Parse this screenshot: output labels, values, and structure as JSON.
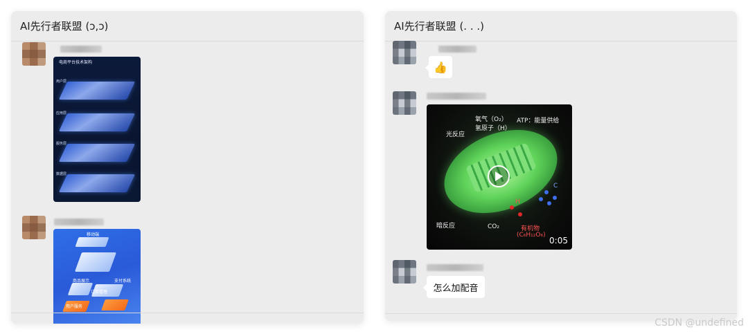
{
  "left_panel": {
    "title": "AI先行者联盟 (ɔ,ɔ)",
    "messages": [
      {
        "type": "image",
        "image_title": "电商平台技术架构",
        "layer_labels": [
          "用户层",
          "应用层",
          "服务层",
          "数据层"
        ]
      },
      {
        "type": "image",
        "image_labels": [
          "移动端",
          "商品展示",
          "订单管理",
          "支付系统",
          "用户服务"
        ]
      }
    ]
  },
  "right_panel": {
    "title": "AI先行者联盟 (. . .)",
    "messages": [
      {
        "type": "text",
        "content": "👍"
      },
      {
        "type": "video",
        "duration": "0:05",
        "labels": {
          "light": "光反应",
          "oxygen": "氧气（O₂）",
          "hydrogen": "氢原子（H）",
          "atp": "ATP：能量供给",
          "dark": "暗反应",
          "co2": "CO₂",
          "organic": "有机物",
          "formula": "(C₆H₁₂O₆)",
          "c": "C",
          "h": "H"
        }
      },
      {
        "type": "text",
        "content": "怎么加配音"
      }
    ]
  },
  "watermark": "CSDN @undefined",
  "colors": {
    "panel_bg": "#ececec",
    "bubble_bg": "#ffffff",
    "divider": "#d9d9d9"
  }
}
